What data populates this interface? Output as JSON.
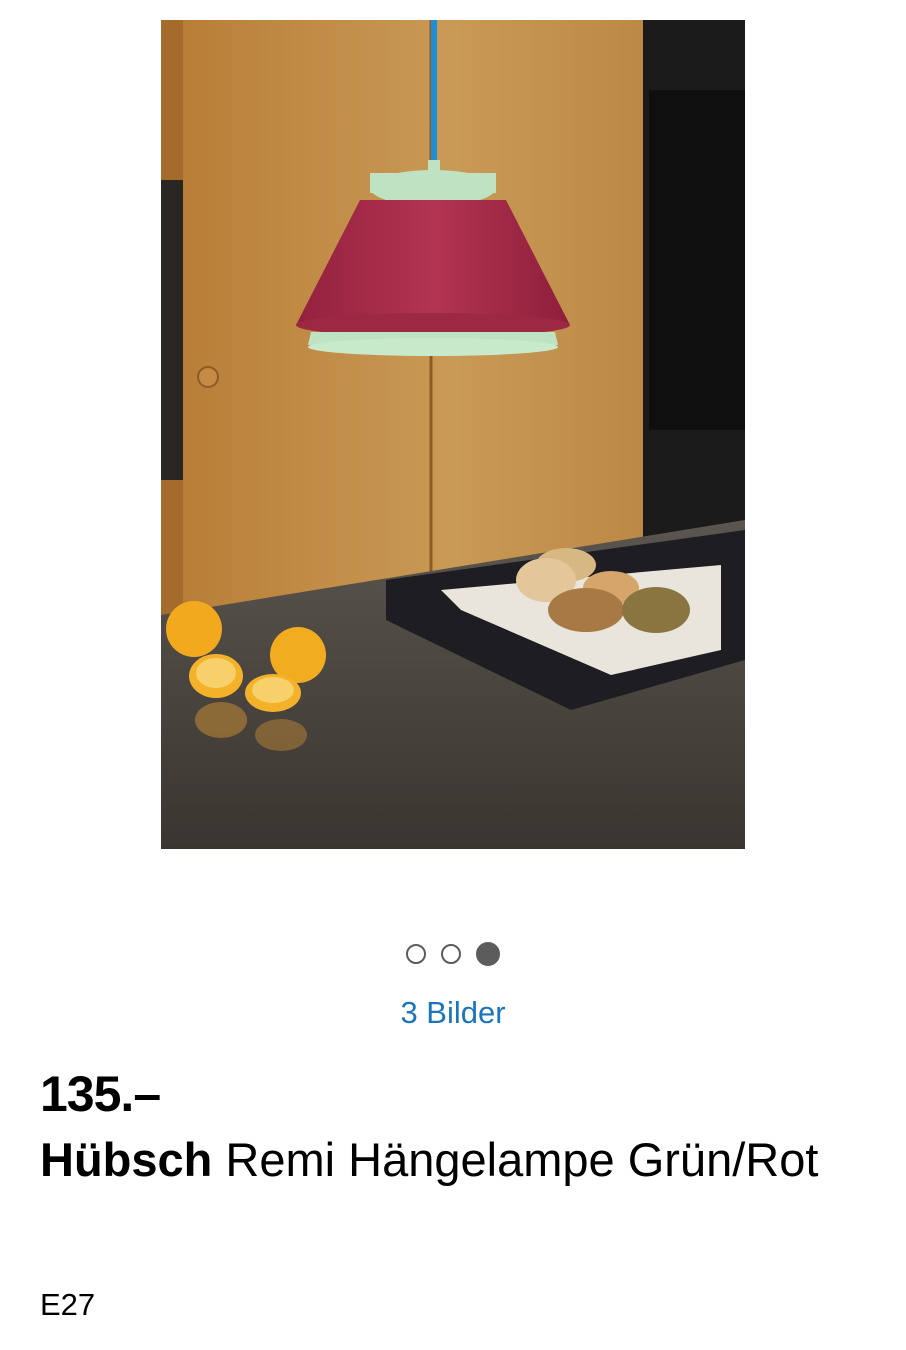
{
  "gallery": {
    "image_name": "product-photo",
    "dot_count": 3,
    "active_index": 2,
    "images_link_label": "3 Bilder"
  },
  "product": {
    "price": "135.–",
    "brand": "Hübsch",
    "name": "Remi Hängelampe Grün/Rot",
    "variant": "E27"
  },
  "colors": {
    "link": "#1b75bc",
    "dot": "#5c5c5c",
    "lamp_red": "#a52a48",
    "lamp_green": "#bfe3c2",
    "cable_blue": "#1e8fd6"
  }
}
